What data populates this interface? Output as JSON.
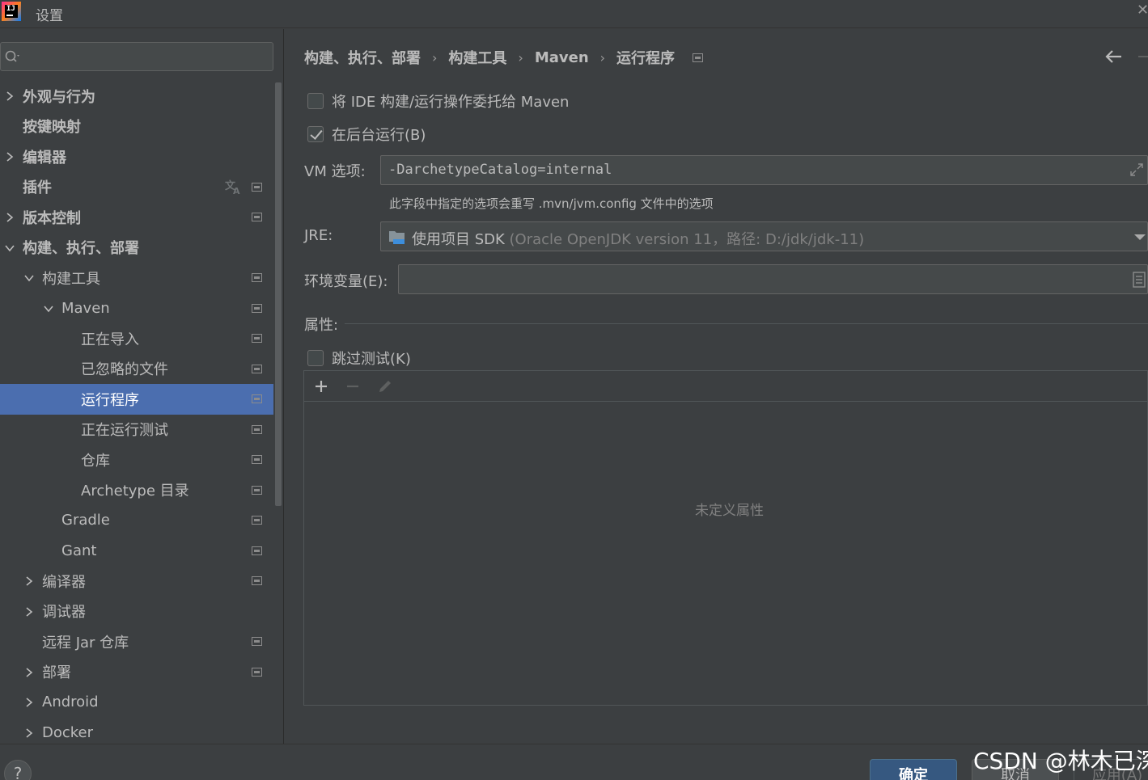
{
  "window": {
    "title": "设置",
    "logo_text": "IJ"
  },
  "search": {
    "placeholder": ""
  },
  "sidebar": {
    "items": [
      {
        "label": "外观与行为",
        "bold": true,
        "expandable": true,
        "expanded": false,
        "indent": 0,
        "proj": false,
        "translate": false
      },
      {
        "label": "按键映射",
        "bold": true,
        "expandable": false,
        "indent": 0,
        "proj": false,
        "translate": false
      },
      {
        "label": "编辑器",
        "bold": true,
        "expandable": true,
        "expanded": false,
        "indent": 0,
        "proj": false,
        "translate": false
      },
      {
        "label": "插件",
        "bold": true,
        "expandable": false,
        "indent": 0,
        "proj": true,
        "translate": true
      },
      {
        "label": "版本控制",
        "bold": true,
        "expandable": true,
        "expanded": false,
        "indent": 0,
        "proj": true,
        "translate": false
      },
      {
        "label": "构建、执行、部署",
        "bold": true,
        "expandable": true,
        "expanded": true,
        "indent": 0,
        "proj": false,
        "translate": false
      },
      {
        "label": "构建工具",
        "bold": false,
        "expandable": true,
        "expanded": true,
        "indent": 1,
        "proj": true,
        "translate": false
      },
      {
        "label": "Maven",
        "bold": false,
        "expandable": true,
        "expanded": true,
        "indent": 2,
        "proj": true,
        "translate": false
      },
      {
        "label": "正在导入",
        "bold": false,
        "expandable": false,
        "indent": 3,
        "proj": true,
        "translate": false
      },
      {
        "label": "已忽略的文件",
        "bold": false,
        "expandable": false,
        "indent": 3,
        "proj": true,
        "translate": false
      },
      {
        "label": "运行程序",
        "bold": false,
        "expandable": false,
        "indent": 3,
        "proj": true,
        "translate": false,
        "selected": true
      },
      {
        "label": "正在运行测试",
        "bold": false,
        "expandable": false,
        "indent": 3,
        "proj": true,
        "translate": false
      },
      {
        "label": "仓库",
        "bold": false,
        "expandable": false,
        "indent": 3,
        "proj": true,
        "translate": false
      },
      {
        "label": "Archetype 目录",
        "bold": false,
        "expandable": false,
        "indent": 3,
        "proj": true,
        "translate": false
      },
      {
        "label": "Gradle",
        "bold": false,
        "expandable": false,
        "indent": 2,
        "proj": true,
        "translate": false
      },
      {
        "label": "Gant",
        "bold": false,
        "expandable": false,
        "indent": 2,
        "proj": true,
        "translate": false
      },
      {
        "label": "编译器",
        "bold": false,
        "expandable": true,
        "expanded": false,
        "indent": 1,
        "proj": true,
        "translate": false
      },
      {
        "label": "调试器",
        "bold": false,
        "expandable": true,
        "expanded": false,
        "indent": 1,
        "proj": false,
        "translate": false
      },
      {
        "label": "远程 Jar 仓库",
        "bold": false,
        "expandable": false,
        "indent": 1,
        "proj": true,
        "translate": false
      },
      {
        "label": "部署",
        "bold": false,
        "expandable": true,
        "expanded": false,
        "indent": 1,
        "proj": true,
        "translate": false
      },
      {
        "label": "Android",
        "bold": false,
        "expandable": true,
        "expanded": false,
        "indent": 1,
        "proj": false,
        "translate": false
      },
      {
        "label": "Docker",
        "bold": false,
        "expandable": true,
        "expanded": false,
        "indent": 1,
        "proj": false,
        "translate": false
      }
    ]
  },
  "breadcrumb": [
    "构建、执行、部署",
    "构建工具",
    "Maven",
    "运行程序"
  ],
  "breadcrumb_sep": "›",
  "form": {
    "delegate_label": "将 IDE 构建/运行操作委托给 Maven",
    "delegate_checked": false,
    "background_label": "在后台运行(B)",
    "background_checked": true,
    "vm_label": "VM 选项:",
    "vm_value": "-DarchetypeCatalog=internal",
    "vm_hint": "此字段中指定的选项会重写 .mvn/jvm.config 文件中的选项",
    "jre_label": "JRE:",
    "jre_value_main": "使用项目 SDK",
    "jre_value_detail": " (Oracle OpenJDK version 11，路径: D:/jdk/jdk-11)",
    "env_label": "环境变量(E):",
    "env_value": "",
    "props_label": "属性:",
    "skip_tests_label": "跳过测试(K)",
    "skip_tests_checked": false,
    "empty_props": "未定义属性"
  },
  "buttons": {
    "help": "?",
    "ok": "确定",
    "cancel": "取消",
    "apply": "应用(A)"
  },
  "watermark": "CSDN @林木已深",
  "colors": {
    "background": "#3c3f41",
    "selection": "#4b6eaf",
    "primary_button": "#365880",
    "text": "#bbbbbb"
  }
}
